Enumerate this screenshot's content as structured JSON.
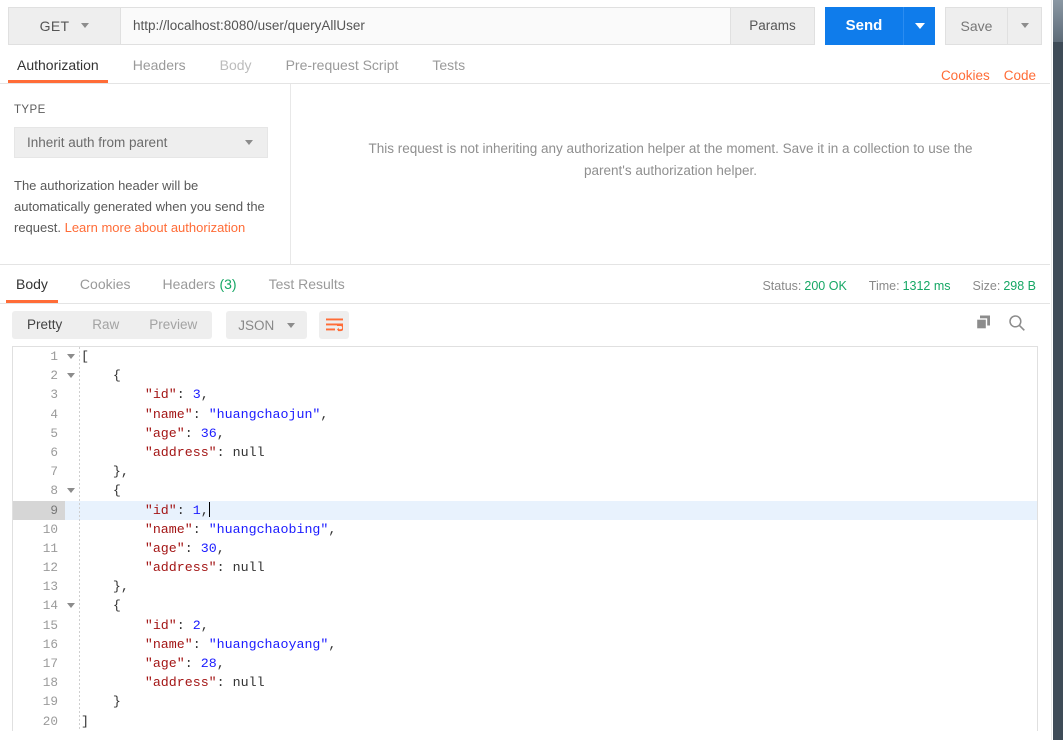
{
  "request": {
    "method": "GET",
    "url": "http://localhost:8080/user/queryAllUser",
    "params_label": "Params",
    "send_label": "Send",
    "save_label": "Save"
  },
  "request_tabs": [
    {
      "label": "Authorization",
      "state": "active"
    },
    {
      "label": "Headers",
      "state": "normal"
    },
    {
      "label": "Body",
      "state": "dim"
    },
    {
      "label": "Pre-request Script",
      "state": "normal"
    },
    {
      "label": "Tests",
      "state": "normal"
    }
  ],
  "request_tabs_right": [
    {
      "label": "Cookies"
    },
    {
      "label": "Code"
    }
  ],
  "auth": {
    "type_label": "TYPE",
    "selected_type": "Inherit auth from parent",
    "description_text": "The authorization header will be automatically generated when you send the request. ",
    "description_link": "Learn more about authorization",
    "note": "This request is not inheriting any authorization helper at the moment. Save it in a collection to use the parent's authorization helper."
  },
  "response_tabs": [
    {
      "label": "Body",
      "count": "",
      "state": "active"
    },
    {
      "label": "Cookies",
      "count": "",
      "state": "normal"
    },
    {
      "label": "Headers",
      "count": "(3)",
      "state": "normal"
    },
    {
      "label": "Test Results",
      "count": "",
      "state": "normal"
    }
  ],
  "response_meta": {
    "status_label": "Status:",
    "status_value": "200 OK",
    "time_label": "Time:",
    "time_value": "1312 ms",
    "size_label": "Size:",
    "size_value": "298 B"
  },
  "format_bar": {
    "views": [
      {
        "label": "Pretty",
        "state": "active"
      },
      {
        "label": "Raw",
        "state": "normal"
      },
      {
        "label": "Preview",
        "state": "normal"
      }
    ],
    "language": "JSON",
    "wrap_icon": "wrap-lines-icon",
    "copy_icon": "copy-icon",
    "search_icon": "search-icon"
  },
  "colors": {
    "accent_orange": "#ff6c37",
    "send_blue": "#0f7ceb",
    "status_green": "#16a765",
    "key_red": "#a31515",
    "value_blue": "#1a1aff",
    "active_line": "#e8f2fd"
  },
  "code": {
    "active_line": 9,
    "lines": [
      {
        "n": 1,
        "fold": true,
        "segments": [
          {
            "t": "[",
            "c": "p"
          }
        ]
      },
      {
        "n": 2,
        "fold": true,
        "segments": [
          {
            "t": "    {",
            "c": "p"
          }
        ]
      },
      {
        "n": 3,
        "fold": false,
        "segments": [
          {
            "t": "        ",
            "c": "p"
          },
          {
            "t": "\"id\"",
            "c": "k"
          },
          {
            "t": ": ",
            "c": "p"
          },
          {
            "t": "3",
            "c": "n"
          },
          {
            "t": ",",
            "c": "p"
          }
        ]
      },
      {
        "n": 4,
        "fold": false,
        "segments": [
          {
            "t": "        ",
            "c": "p"
          },
          {
            "t": "\"name\"",
            "c": "k"
          },
          {
            "t": ": ",
            "c": "p"
          },
          {
            "t": "\"huangchaojun\"",
            "c": "s"
          },
          {
            "t": ",",
            "c": "p"
          }
        ]
      },
      {
        "n": 5,
        "fold": false,
        "segments": [
          {
            "t": "        ",
            "c": "p"
          },
          {
            "t": "\"age\"",
            "c": "k"
          },
          {
            "t": ": ",
            "c": "p"
          },
          {
            "t": "36",
            "c": "n"
          },
          {
            "t": ",",
            "c": "p"
          }
        ]
      },
      {
        "n": 6,
        "fold": false,
        "segments": [
          {
            "t": "        ",
            "c": "p"
          },
          {
            "t": "\"address\"",
            "c": "k"
          },
          {
            "t": ": ",
            "c": "p"
          },
          {
            "t": "null",
            "c": "nul"
          }
        ]
      },
      {
        "n": 7,
        "fold": false,
        "segments": [
          {
            "t": "    },",
            "c": "p"
          }
        ]
      },
      {
        "n": 8,
        "fold": true,
        "segments": [
          {
            "t": "    {",
            "c": "p"
          }
        ]
      },
      {
        "n": 9,
        "fold": false,
        "segments": [
          {
            "t": "        ",
            "c": "p"
          },
          {
            "t": "\"id\"",
            "c": "k"
          },
          {
            "t": ": ",
            "c": "p"
          },
          {
            "t": "1",
            "c": "n"
          },
          {
            "t": ",",
            "c": "p"
          }
        ],
        "caret": true
      },
      {
        "n": 10,
        "fold": false,
        "segments": [
          {
            "t": "        ",
            "c": "p"
          },
          {
            "t": "\"name\"",
            "c": "k"
          },
          {
            "t": ": ",
            "c": "p"
          },
          {
            "t": "\"huangchaobing\"",
            "c": "s"
          },
          {
            "t": ",",
            "c": "p"
          }
        ]
      },
      {
        "n": 11,
        "fold": false,
        "segments": [
          {
            "t": "        ",
            "c": "p"
          },
          {
            "t": "\"age\"",
            "c": "k"
          },
          {
            "t": ": ",
            "c": "p"
          },
          {
            "t": "30",
            "c": "n"
          },
          {
            "t": ",",
            "c": "p"
          }
        ]
      },
      {
        "n": 12,
        "fold": false,
        "segments": [
          {
            "t": "        ",
            "c": "p"
          },
          {
            "t": "\"address\"",
            "c": "k"
          },
          {
            "t": ": ",
            "c": "p"
          },
          {
            "t": "null",
            "c": "nul"
          }
        ]
      },
      {
        "n": 13,
        "fold": false,
        "segments": [
          {
            "t": "    },",
            "c": "p"
          }
        ]
      },
      {
        "n": 14,
        "fold": true,
        "segments": [
          {
            "t": "    {",
            "c": "p"
          }
        ]
      },
      {
        "n": 15,
        "fold": false,
        "segments": [
          {
            "t": "        ",
            "c": "p"
          },
          {
            "t": "\"id\"",
            "c": "k"
          },
          {
            "t": ": ",
            "c": "p"
          },
          {
            "t": "2",
            "c": "n"
          },
          {
            "t": ",",
            "c": "p"
          }
        ]
      },
      {
        "n": 16,
        "fold": false,
        "segments": [
          {
            "t": "        ",
            "c": "p"
          },
          {
            "t": "\"name\"",
            "c": "k"
          },
          {
            "t": ": ",
            "c": "p"
          },
          {
            "t": "\"huangchaoyang\"",
            "c": "s"
          },
          {
            "t": ",",
            "c": "p"
          }
        ]
      },
      {
        "n": 17,
        "fold": false,
        "segments": [
          {
            "t": "        ",
            "c": "p"
          },
          {
            "t": "\"age\"",
            "c": "k"
          },
          {
            "t": ": ",
            "c": "p"
          },
          {
            "t": "28",
            "c": "n"
          },
          {
            "t": ",",
            "c": "p"
          }
        ]
      },
      {
        "n": 18,
        "fold": false,
        "segments": [
          {
            "t": "        ",
            "c": "p"
          },
          {
            "t": "\"address\"",
            "c": "k"
          },
          {
            "t": ": ",
            "c": "p"
          },
          {
            "t": "null",
            "c": "nul"
          }
        ]
      },
      {
        "n": 19,
        "fold": false,
        "segments": [
          {
            "t": "    }",
            "c": "p"
          }
        ]
      },
      {
        "n": 20,
        "fold": false,
        "segments": [
          {
            "t": "]",
            "c": "p"
          }
        ]
      }
    ]
  }
}
